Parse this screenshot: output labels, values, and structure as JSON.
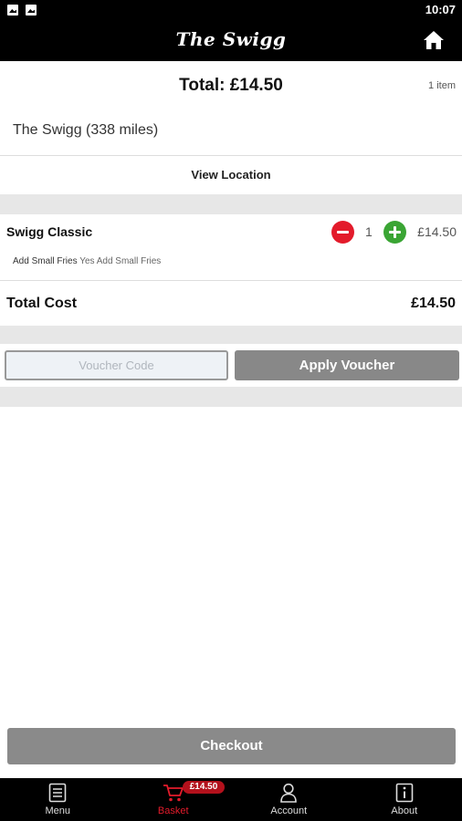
{
  "status_bar": {
    "time": "10:07",
    "icons": [
      "image-icon",
      "image-icon"
    ]
  },
  "header": {
    "title": "The Swigg",
    "home_icon": "home-icon"
  },
  "summary": {
    "total": "Total: £14.50",
    "item_count": "1 item",
    "store": "The Swigg (338 miles)"
  },
  "view_location": "View Location",
  "basket": {
    "items": [
      {
        "name": "Swigg Classic",
        "quantity": "1",
        "price": "£14.50",
        "extra_label": "Add Small Fries",
        "extra_value": "Yes Add Small Fries"
      }
    ]
  },
  "total_cost": {
    "label": "Total Cost",
    "amount": "£14.50"
  },
  "voucher": {
    "placeholder": "Voucher Code",
    "apply_label": "Apply Voucher"
  },
  "checkout_label": "Checkout",
  "tabs": [
    {
      "label": "Menu",
      "icon": "menu-icon"
    },
    {
      "label": "Basket",
      "icon": "cart-icon",
      "badge": "£14.50",
      "active": true
    },
    {
      "label": "Account",
      "icon": "user-icon"
    },
    {
      "label": "About",
      "icon": "info-icon"
    }
  ],
  "colors": {
    "brand_black": "#000000",
    "minus_red": "#e31b2b",
    "plus_green": "#3aa534",
    "active_tab": "#e31b2b",
    "badge": "#b3111c",
    "button_gray": "#888888"
  }
}
